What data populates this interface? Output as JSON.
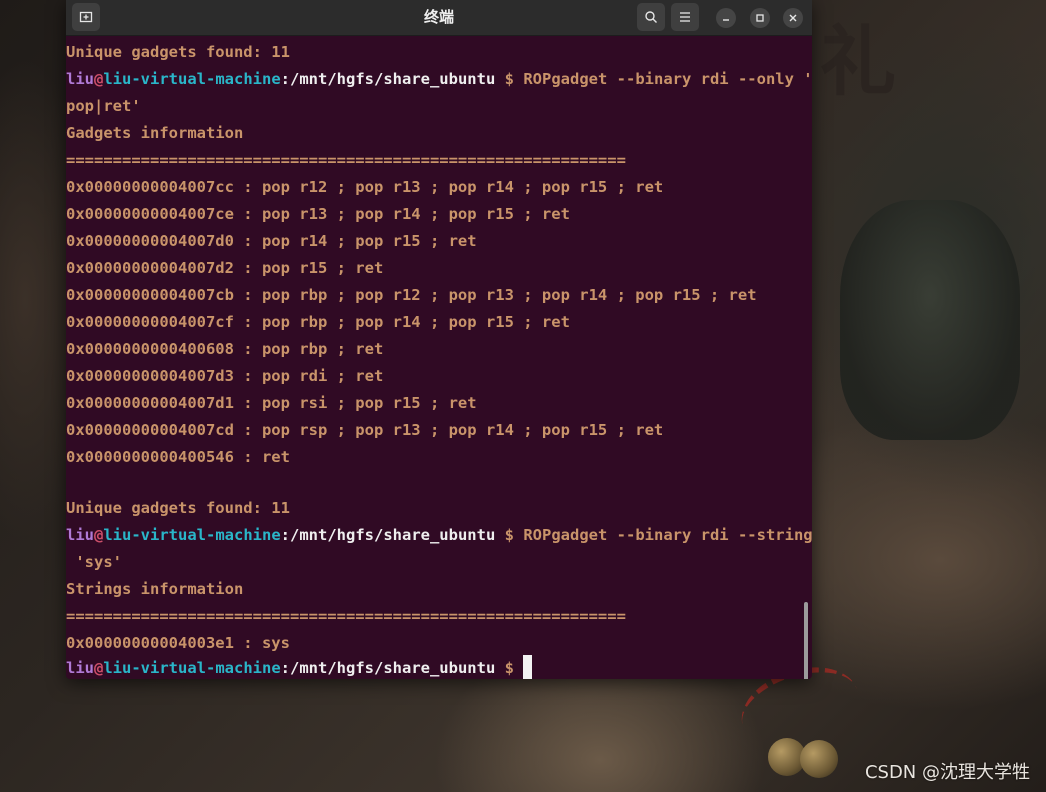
{
  "window": {
    "title": "终端"
  },
  "terminal": {
    "prompt": {
      "user": "liu",
      "at": "@",
      "host": "liu-virtual-machine",
      "colon": ":",
      "path": "/mnt/hgfs/share_ubuntu",
      "dollar": "$"
    },
    "lines": {
      "l0": "Unique gadgets found: 11",
      "cmd1_a": "ROPgadget --binary rdi --only '",
      "cmd1_b": "pop|ret'",
      "l3": "Gadgets information",
      "l4": "============================================================",
      "g1": "0x00000000004007cc : pop r12 ; pop r13 ; pop r14 ; pop r15 ; ret",
      "g2": "0x00000000004007ce : pop r13 ; pop r14 ; pop r15 ; ret",
      "g3": "0x00000000004007d0 : pop r14 ; pop r15 ; ret",
      "g4": "0x00000000004007d2 : pop r15 ; ret",
      "g5": "0x00000000004007cb : pop rbp ; pop r12 ; pop r13 ; pop r14 ; pop r15 ; ret",
      "g6": "0x00000000004007cf : pop rbp ; pop r14 ; pop r15 ; ret",
      "g7": "0x0000000000400608 : pop rbp ; ret",
      "g8": "0x00000000004007d3 : pop rdi ; ret",
      "g9": "0x00000000004007d1 : pop rsi ; pop r15 ; ret",
      "g10": "0x00000000004007cd : pop rsp ; pop r13 ; pop r14 ; pop r15 ; ret",
      "g11": "0x0000000000400546 : ret",
      "l17": "Unique gadgets found: 11",
      "cmd2_a": "ROPgadget --binary rdi --string",
      "cmd2_b": " 'sys'",
      "l20": "Strings information",
      "l21": "============================================================",
      "l22": "0x00000000004003e1 : sys"
    }
  },
  "wallpaper": {
    "watermark": "CSDN @沈理大学牲",
    "glyph": "礼"
  }
}
